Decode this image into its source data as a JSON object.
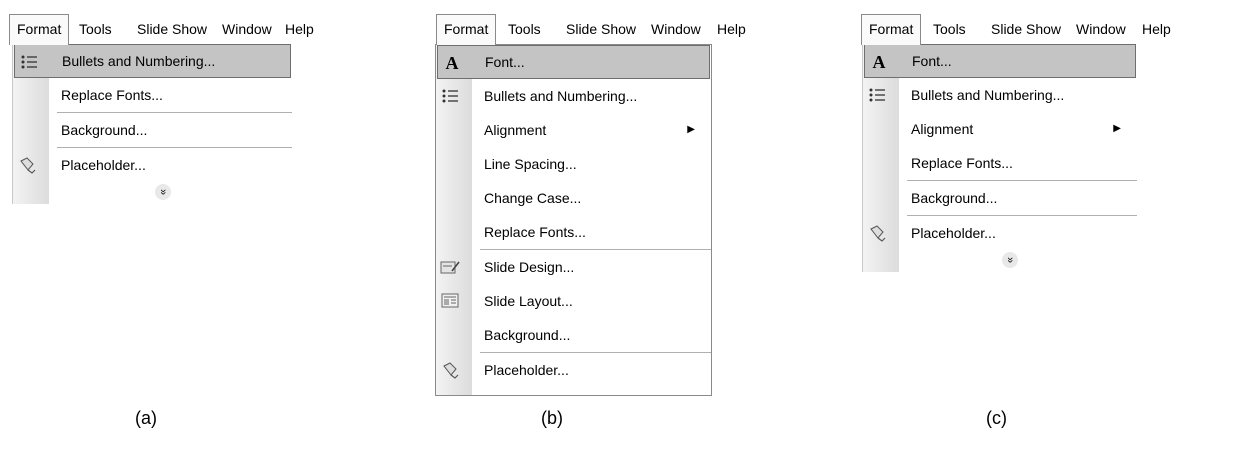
{
  "menubar": [
    "Format",
    "Tools",
    "Slide Show",
    "Window",
    "Help"
  ],
  "panels": [
    {
      "caption": "(a)",
      "items": [
        {
          "label": "Bullets and Numbering...",
          "icon": "bullets-icon",
          "selected": true
        },
        {
          "label": "Replace Fonts...",
          "icon": ""
        },
        {
          "label": "Background...",
          "icon": ""
        },
        {
          "label": "Placeholder...",
          "icon": "placeholder-icon"
        }
      ],
      "expand": "»"
    },
    {
      "caption": "(b)",
      "items": [
        {
          "label": "Font...",
          "icon": "font-icon",
          "selected": true
        },
        {
          "label": "Bullets and Numbering...",
          "icon": "bullets-icon"
        },
        {
          "label": "Alignment",
          "icon": "",
          "arrow": "▶"
        },
        {
          "label": "Line Spacing...",
          "icon": ""
        },
        {
          "label": "Change Case...",
          "icon": ""
        },
        {
          "label": "Replace Fonts...",
          "icon": ""
        },
        {
          "label": "Slide Design...",
          "icon": "slide-design-icon"
        },
        {
          "label": "Slide Layout...",
          "icon": "slide-layout-icon"
        },
        {
          "label": "Background...",
          "icon": ""
        },
        {
          "label": "Placeholder...",
          "icon": "placeholder-icon"
        }
      ]
    },
    {
      "caption": "(c)",
      "items": [
        {
          "label": "Font...",
          "icon": "font-icon",
          "selected": true
        },
        {
          "label": "Bullets and Numbering...",
          "icon": "bullets-icon"
        },
        {
          "label": "Alignment",
          "icon": "",
          "arrow": "▶"
        },
        {
          "label": "Replace Fonts...",
          "icon": ""
        },
        {
          "label": "Background...",
          "icon": ""
        },
        {
          "label": "Placeholder...",
          "icon": "placeholder-icon"
        }
      ],
      "expand": "»"
    }
  ]
}
